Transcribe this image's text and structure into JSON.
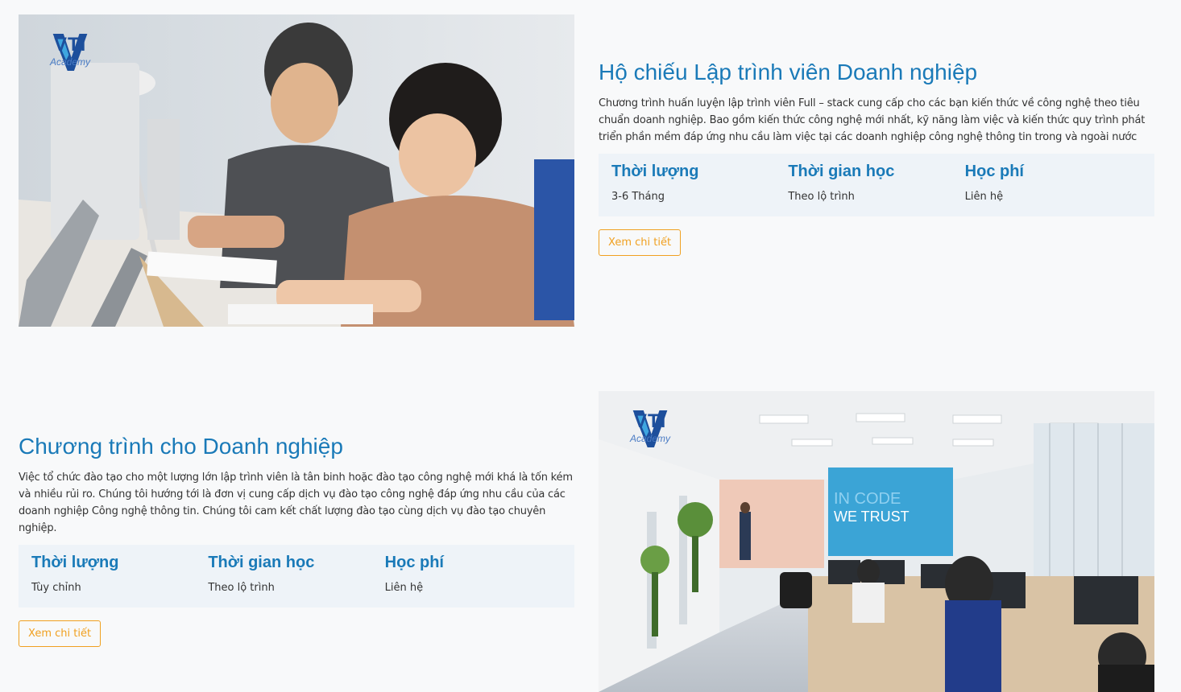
{
  "programs": [
    {
      "logo_text": "VTI",
      "logo_sub": "Academy",
      "title": "Hộ chiếu Lập trình viên Doanh nghiệp",
      "description": "Chương trình huấn luyện lập trình viên Full – stack cung cấp cho các bạn kiến thức về công nghệ theo tiêu chuẩn doanh nghiệp. Bao gồm kiến thức công nghệ mới nhất, kỹ năng làm việc và kiến thức quy trình phát triển phần mềm đáp ứng nhu cầu làm việc tại các doanh nghiệp công nghệ thông tin trong và ngoài nước",
      "info": [
        {
          "label": "Thời lượng",
          "value": "3-6 Tháng"
        },
        {
          "label": "Thời gian học",
          "value": "Theo lộ trình"
        },
        {
          "label": "Học phí",
          "value": "Liên hệ"
        }
      ],
      "button_label": "Xem chi tiết"
    },
    {
      "logo_text": "VTI",
      "logo_sub": "Academy",
      "wall_text_1": "IN CODE",
      "wall_text_2": "WE TRUST",
      "title": "Chương trình cho Doanh nghiệp",
      "description": "Việc tổ chức đào tạo cho một lượng lớn lập trình viên là tân binh hoặc đào tạo công nghệ mới khá là tốn kém và nhiều rủi ro.  Chúng tôi hướng tới là đơn vị cung cấp dịch vụ đào tạo công nghệ đáp ứng nhu cầu của các doanh nghiệp Công nghệ thông tin. Chúng tôi cam kết chất lượng đào tạo cùng dịch vụ đào tạo chuyên nghiệp.",
      "info": [
        {
          "label": "Thời lượng",
          "value": "Tùy chỉnh"
        },
        {
          "label": "Thời gian học",
          "value": "Theo lộ trình"
        },
        {
          "label": "Học phí",
          "value": "Liên hệ"
        }
      ],
      "button_label": "Xem chi tiết"
    }
  ],
  "colors": {
    "title": "#1a7ab8",
    "button": "#f0a020",
    "info_bg": "#eef3f8",
    "page_bg": "#f8f9fa"
  }
}
